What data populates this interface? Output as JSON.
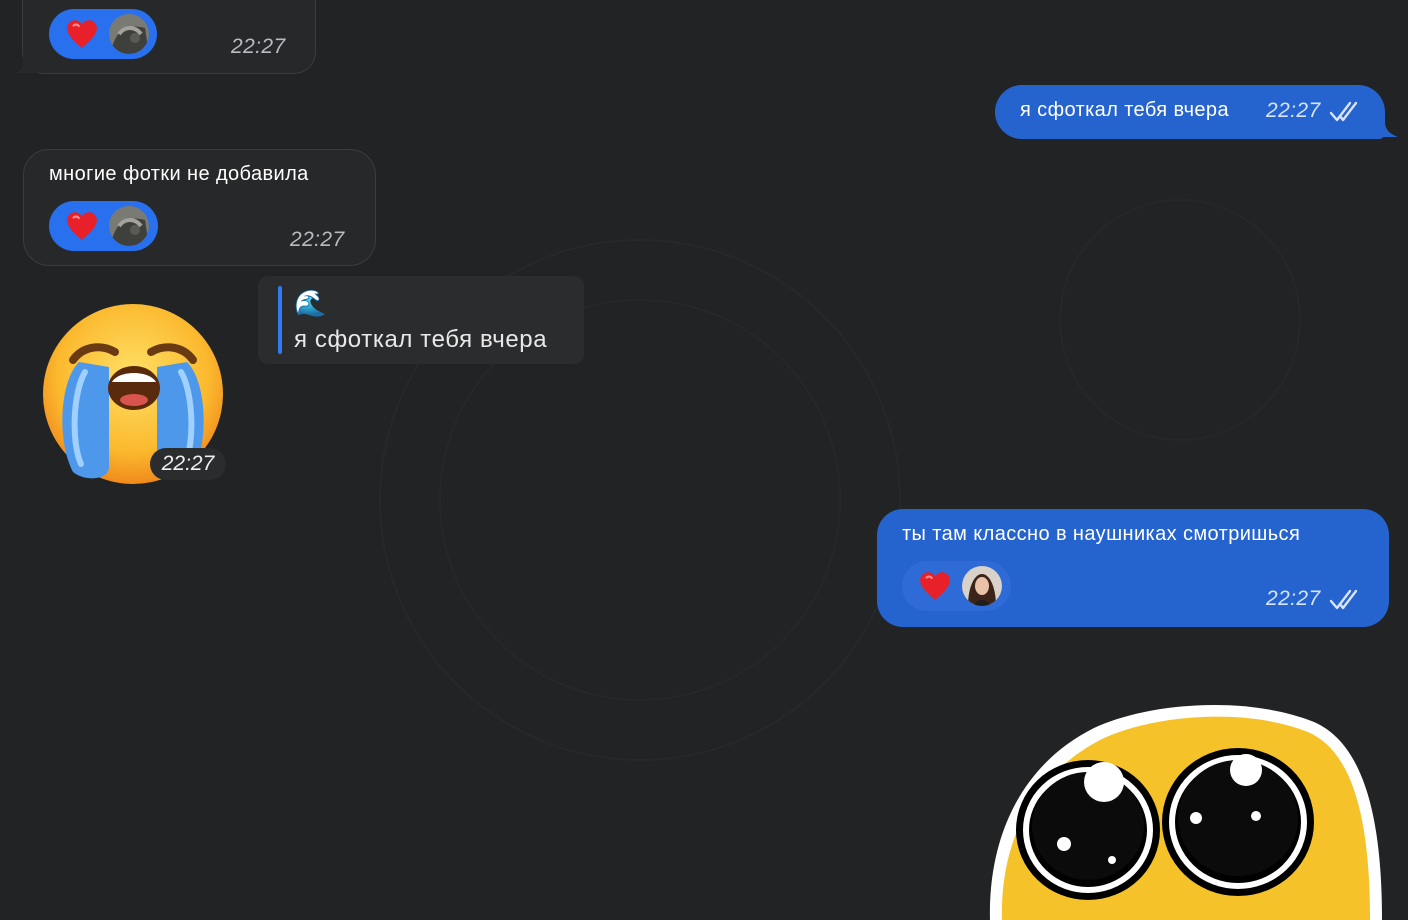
{
  "messages": {
    "m1": {
      "time": "22:27",
      "reaction": "heart"
    },
    "m2": {
      "text": "я сфоткал тебя вчера",
      "time": "22:27",
      "status": "read"
    },
    "m3": {
      "text": "многие фотки не добавила",
      "time": "22:27",
      "reaction": "heart"
    },
    "m4": {
      "reply_emoji": "🌊",
      "reply_text": "я сфоткал тебя вчера",
      "sticker": "crying-emoji-sticker",
      "time": "22:27"
    },
    "m5": {
      "text": "ты там классно в наушниках смотришься",
      "time": "22:27",
      "status": "read",
      "reaction": "heart"
    },
    "m6": {
      "sticker": "pleading-eyes-sticker"
    }
  },
  "colors": {
    "background": "#212325",
    "incoming_bubble": "#26282a",
    "outgoing_bubble": "#2563cf",
    "reaction_pill": "#2870ee",
    "reply_bar": "#2f7bf5"
  }
}
